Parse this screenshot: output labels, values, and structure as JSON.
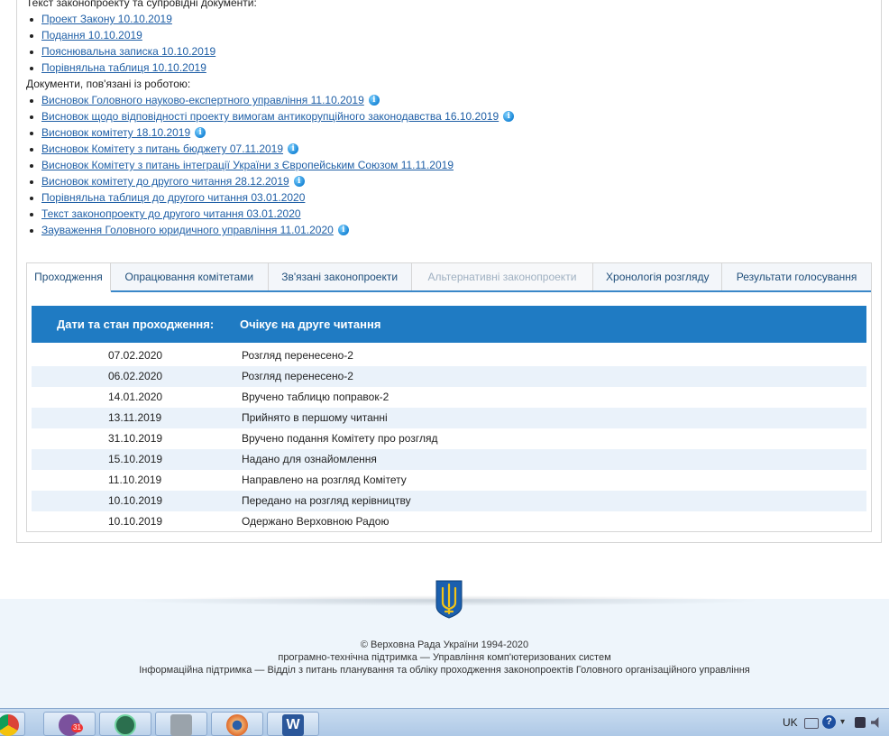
{
  "documents": {
    "bill_heading": "Текст законопроекту та супровідні документи:",
    "bill_docs": [
      {
        "label": "Проект Закону 10.10.2019",
        "info": false
      },
      {
        "label": "Подання 10.10.2019",
        "info": false
      },
      {
        "label": "Пояснювальна записка 10.10.2019",
        "info": false
      },
      {
        "label": "Порівняльна таблиця 10.10.2019",
        "info": false
      }
    ],
    "related_heading": "Документи, пов'язані із роботою:",
    "related_docs": [
      {
        "label": "Висновок Головного науково-експертного управління 11.10.2019",
        "info": true
      },
      {
        "label": "Висновок щодо відповідності проекту вимогам антикорупційного законодавства 16.10.2019",
        "info": true
      },
      {
        "label": "Висновок комітету 18.10.2019",
        "info": true
      },
      {
        "label": "Висновок Комітету з питань бюджету 07.11.2019",
        "info": true
      },
      {
        "label": "Висновок Комітету з питань інтеграції України з Європейським Союзом 11.11.2019",
        "info": false
      },
      {
        "label": "Висновок комітету до другого читання 28.12.2019",
        "info": true
      },
      {
        "label": "Порівняльна таблиця до другого читання 03.01.2020",
        "info": false
      },
      {
        "label": "Текст законопроекту до другого читання 03.01.2020",
        "info": false
      },
      {
        "label": "Зауваження Головного юридичного управління 11.01.2020",
        "info": true
      }
    ],
    "info_glyph": "i"
  },
  "tabs": [
    {
      "label": "Проходження",
      "state": "active"
    },
    {
      "label": "Опрацювання комітетами",
      "state": "normal"
    },
    {
      "label": "Зв'язані законопроекти",
      "state": "normal"
    },
    {
      "label": "Альтернативні законопроекти",
      "state": "disabled"
    },
    {
      "label": "Хронологія розгляду",
      "state": "normal"
    },
    {
      "label": "Результати голосування",
      "state": "normal"
    }
  ],
  "status_panel": {
    "header_key": "Дати та стан проходження:",
    "header_value": "Очікує на друге читання",
    "rows": [
      {
        "date": "07.02.2020",
        "status": "Розгляд перенесено-2"
      },
      {
        "date": "06.02.2020",
        "status": "Розгляд перенесено-2"
      },
      {
        "date": "14.01.2020",
        "status": "Вручено таблицю поправок-2"
      },
      {
        "date": "13.11.2019",
        "status": "Прийнято в першому читанні"
      },
      {
        "date": "31.10.2019",
        "status": "Вручено подання Комітету про розгляд"
      },
      {
        "date": "15.10.2019",
        "status": "Надано для ознайомлення"
      },
      {
        "date": "11.10.2019",
        "status": "Направлено на розгляд Комітету"
      },
      {
        "date": "10.10.2019",
        "status": "Передано на розгляд керівництву"
      },
      {
        "date": "10.10.2019",
        "status": "Одержано Верховною Радою"
      }
    ]
  },
  "footer": {
    "copyright": "© Верховна Рада України 1994-2020",
    "support": "програмно-технічна підтримка — Управління комп'ютеризованих систем",
    "info_support": "Інформаційна підтримка — Відділ з питань планування та обліку проходження законопроектів Головного організаційного управління"
  },
  "taskbar": {
    "apps": [
      "chrome-icon",
      "viber-icon",
      "app-icon",
      "printer-icon",
      "eye-icon",
      "word-icon"
    ],
    "viber_badge": "31",
    "word_glyph": "W",
    "lang": "UK",
    "help_glyph": "?"
  },
  "colors": {
    "link": "#1f5fa6",
    "header_bar": "#1f7bc3",
    "row_stripe": "#eaf2fa",
    "footer_bg": "#eef5fb"
  }
}
